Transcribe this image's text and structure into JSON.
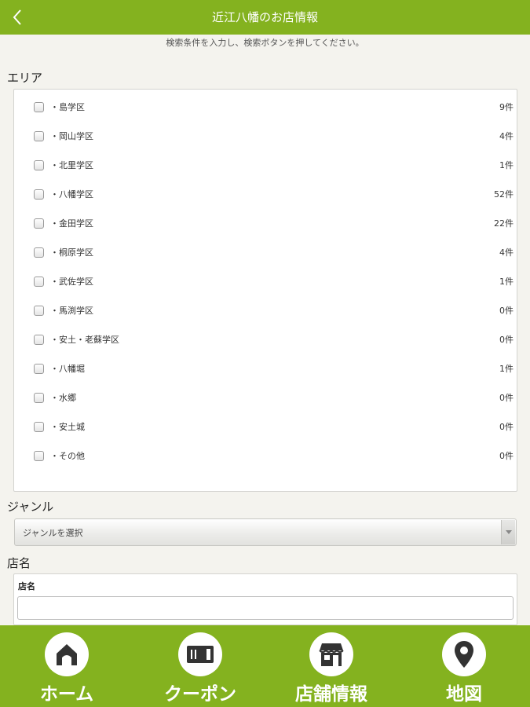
{
  "header": {
    "title": "近江八幡のお店情報"
  },
  "instruction": "検索条件を入力し、検索ボタンを押してください。",
  "area": {
    "label": "エリア",
    "items": [
      {
        "label": "・島学区",
        "count": "9件"
      },
      {
        "label": "・岡山学区",
        "count": "4件"
      },
      {
        "label": "・北里学区",
        "count": "1件"
      },
      {
        "label": "・八幡学区",
        "count": "52件"
      },
      {
        "label": "・金田学区",
        "count": "22件"
      },
      {
        "label": "・桐原学区",
        "count": "4件"
      },
      {
        "label": "・武佐学区",
        "count": "1件"
      },
      {
        "label": "・馬渕学区",
        "count": "0件"
      },
      {
        "label": "・安土・老蘇学区",
        "count": "0件"
      },
      {
        "label": "・八幡堀",
        "count": "1件"
      },
      {
        "label": "・水郷",
        "count": "0件"
      },
      {
        "label": "・安土城",
        "count": "0件"
      },
      {
        "label": "・その他",
        "count": "0件"
      }
    ]
  },
  "genre": {
    "label": "ジャンル",
    "selected": "ジャンルを選択"
  },
  "shop_name": {
    "label": "店名",
    "field_label": "店名",
    "value": ""
  },
  "bottom_nav": [
    {
      "label": "ホーム",
      "icon": "home-icon"
    },
    {
      "label": "クーポン",
      "icon": "ticket-icon"
    },
    {
      "label": "店舗情報",
      "icon": "shop-icon"
    },
    {
      "label": "地図",
      "icon": "map-pin-icon"
    }
  ],
  "colors": {
    "accent": "#84b21f",
    "background": "#f4f3ee"
  }
}
